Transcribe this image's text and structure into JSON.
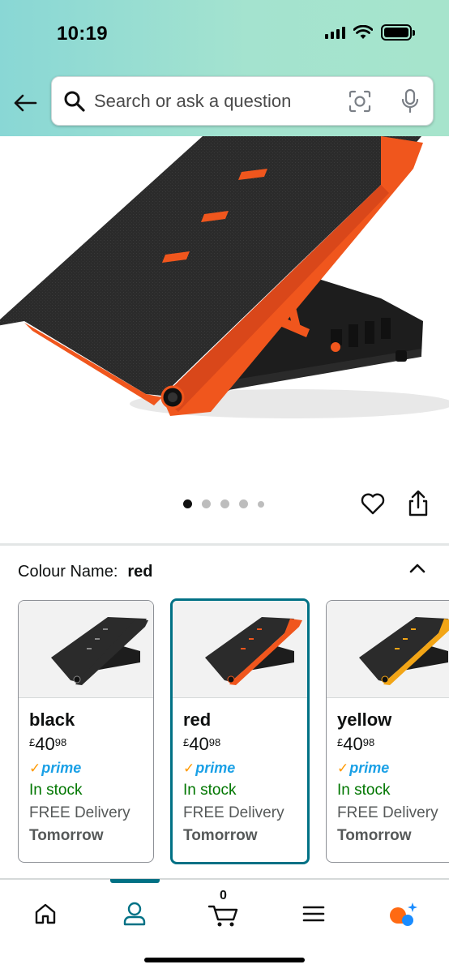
{
  "status_bar": {
    "time": "10:19"
  },
  "search": {
    "placeholder": "Search or ask a question"
  },
  "product": {
    "carousel_dots": 5,
    "active_dot": 0
  },
  "colour": {
    "label": "Colour Name:",
    "value": "red"
  },
  "variants": [
    {
      "name": "black",
      "currency": "£",
      "price_whole": "40",
      "price_fraction": "98",
      "prime": "prime",
      "stock": "In stock",
      "delivery": "FREE Delivery",
      "delivery_day": "Tomorrow",
      "accent": "#2b2b2b",
      "selected": false
    },
    {
      "name": "red",
      "currency": "£",
      "price_whole": "40",
      "price_fraction": "98",
      "prime": "prime",
      "stock": "In stock",
      "delivery": "FREE Delivery",
      "delivery_day": "Tomorrow",
      "accent": "#f0561d",
      "selected": true
    },
    {
      "name": "yellow",
      "currency": "£",
      "price_whole": "40",
      "price_fraction": "98",
      "prime": "prime",
      "stock": "In stock",
      "delivery": "FREE Delivery",
      "delivery_day": "Tomorrow",
      "accent": "#f2a516",
      "selected": false
    }
  ],
  "bottom_nav": {
    "cart_count": "0",
    "active": "account"
  },
  "colors": {
    "teal": "#007185",
    "prime_blue": "#1aa0e6",
    "prime_orange": "#ff9900",
    "stock_green": "#007600",
    "header_gradient_start": "#89d7d5",
    "header_gradient_end": "#a6e4cc"
  }
}
